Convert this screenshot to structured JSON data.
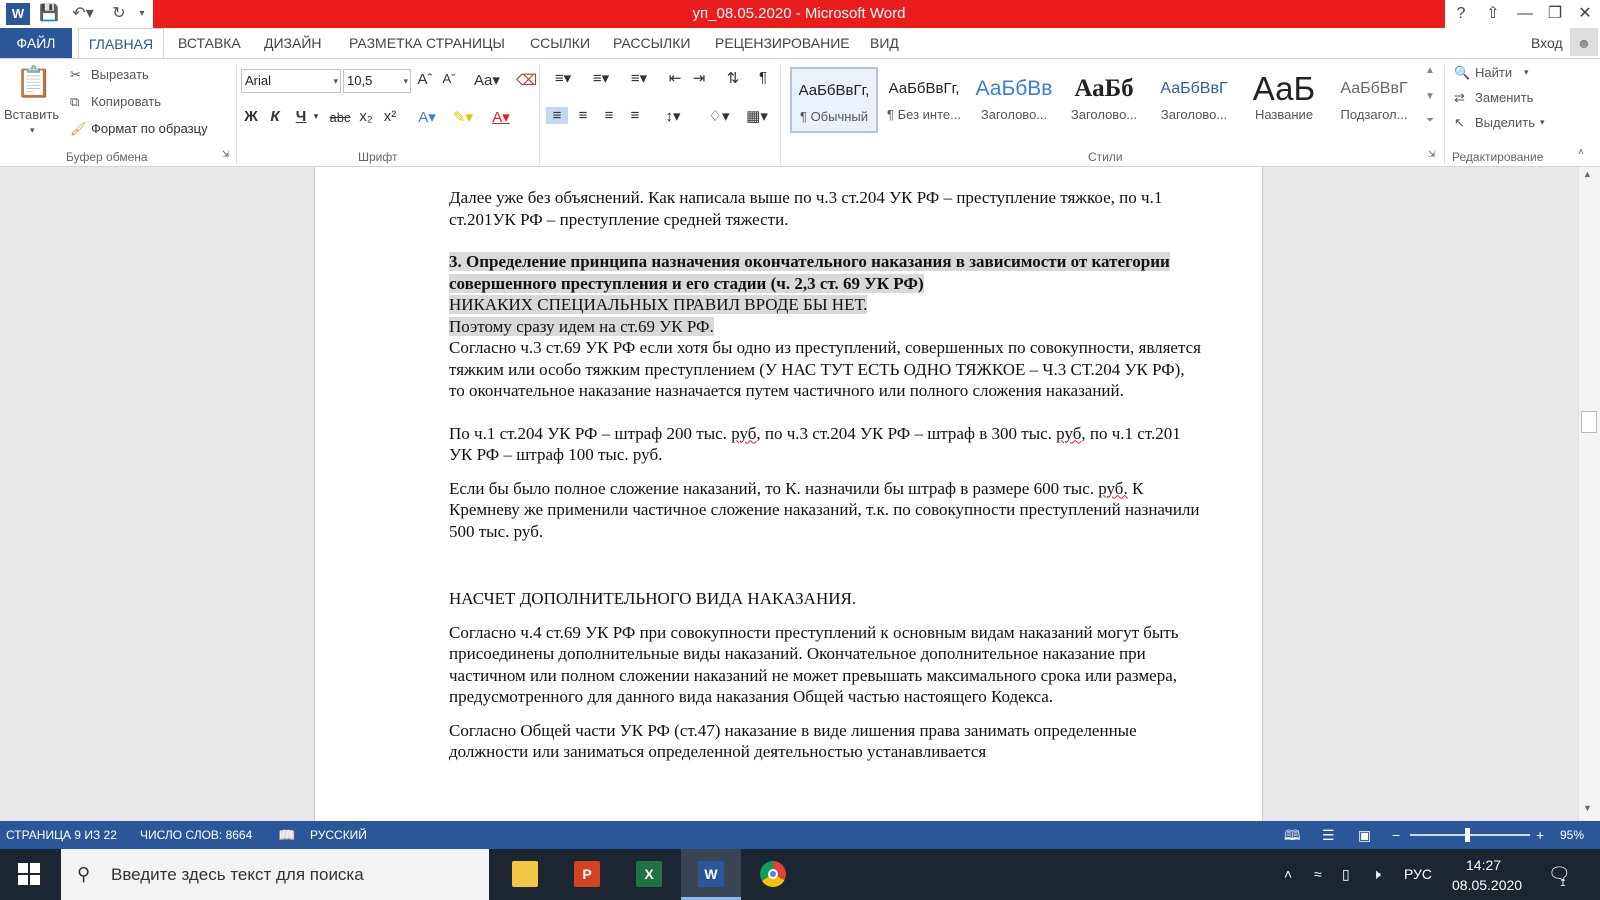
{
  "window": {
    "title": "уп_08.05.2020 -  Microsoft Word",
    "help": "?",
    "signin": "Вход"
  },
  "tabs": [
    "ФАЙЛ",
    "ГЛАВНАЯ",
    "ВСТАВКА",
    "ДИЗАЙН",
    "РАЗМЕТКА СТРАНИЦЫ",
    "ССЫЛКИ",
    "РАССЫЛКИ",
    "РЕЦЕНЗИРОВАНИЕ",
    "ВИД"
  ],
  "ribbon": {
    "clipboard": {
      "paste": "Вставить",
      "cut": "Вырезать",
      "copy": "Копировать",
      "format_painter": "Формат по образцу",
      "label": "Буфер обмена"
    },
    "font": {
      "name": "Arial",
      "size": "10,5",
      "label": "Шрифт",
      "bold": "Ж",
      "italic": "К",
      "underline": "Ч",
      "strike": "abc",
      "sub": "x₂",
      "sup": "x²"
    },
    "paragraph": {
      "label": ""
    },
    "styles": {
      "label": "Стили",
      "items": [
        {
          "preview": "АаБбВвГг,",
          "name": "¶ Обычный"
        },
        {
          "preview": "АаБбВвГг,",
          "name": "¶ Без инте..."
        },
        {
          "preview": "АаБбВв",
          "name": "Заголово..."
        },
        {
          "preview": "АаБб",
          "name": "Заголово..."
        },
        {
          "preview": "АаБбВвГ",
          "name": "Заголово..."
        },
        {
          "preview": "АаБ",
          "name": "Название"
        },
        {
          "preview": "АаБбВвГ",
          "name": "Подзагол..."
        }
      ]
    },
    "editing": {
      "find": "Найти",
      "replace": "Заменить",
      "select": "Выделить",
      "label": "Редактирование"
    }
  },
  "document": {
    "p1": "Далее уже без объяснений.  Как написала выше по ч.3 ст.204 УК РФ – преступление тяжкое, по ч.1 ст.201УК РФ – преступление средней тяжести.",
    "p2": " 3. Определение принципа назначения окончательного наказания в зависимости от категории совершенного преступления и его стадии (ч. 2,3 ст. 69 УК РФ)",
    "p3": "НИКАКИХ СПЕЦИАЛЬНЫХ ПРАВИЛ ВРОДЕ БЫ НЕТ.",
    "p4": "Поэтому сразу идем на ст.69 УК РФ.",
    "p5": "Согласно ч.3 ст.69 УК РФ если хотя бы одно из преступлений, совершенных по совокупности, является тяжким или особо тяжким преступлением (У НАС ТУТ ЕСТЬ ОДНО ТЯЖКОЕ – Ч.3 СТ.204 УК РФ), то окончательное наказание назначается путем частичного или полного сложения наказаний.",
    "p6a": "По ч.1 ст.204 УК РФ – штраф 200 тыс. ",
    "p6b": "руб",
    "p6c": ", по ч.3 ст.204 УК РФ – штраф в 300 тыс. ",
    "p6d": "руб",
    "p6e": ", по ч.1 ст.201 УК РФ – штраф 100 тыс. руб.",
    "p7a": "Если бы было полное сложение наказаний, то К. назначили бы штраф в размере 600 тыс. ",
    "p7b": "руб.",
    "p7c": " К Кремневу же применили частичное сложение наказаний, т.к. по совокупности преступлений назначили 500 тыс. руб.",
    "p8": "НАСЧЕТ ДОПОЛНИТЕЛЬНОГО ВИДА НАКАЗАНИЯ.",
    "p9": "Согласно ч.4 ст.69 УК РФ при совокупности преступлений к основным видам наказаний могут быть присоединены дополнительные виды наказаний. Окончательное дополнительное наказание при частичном или полном сложении наказаний не может превышать максимального срока или размера, предусмотренного для данного вида наказания Общей частью настоящего Кодекса.",
    "p10": "Согласно Общей части УК РФ (ст.47) наказание в виде лишения права занимать определенные должности или заниматься определенной деятельностью устанавливается"
  },
  "status": {
    "page": "СТРАНИЦА 9 ИЗ 22",
    "words": "ЧИСЛО СЛОВ: 8664",
    "lang": "РУССКИЙ",
    "zoom": "95%"
  },
  "taskbar": {
    "search": "Введите здесь текст для поиска",
    "lang": "РУС",
    "time": "14:27",
    "date": "08.05.2020",
    "notif_count": "1"
  },
  "colors": {
    "word_blue": "#2b579a",
    "title_red": "#ea1c1c"
  }
}
